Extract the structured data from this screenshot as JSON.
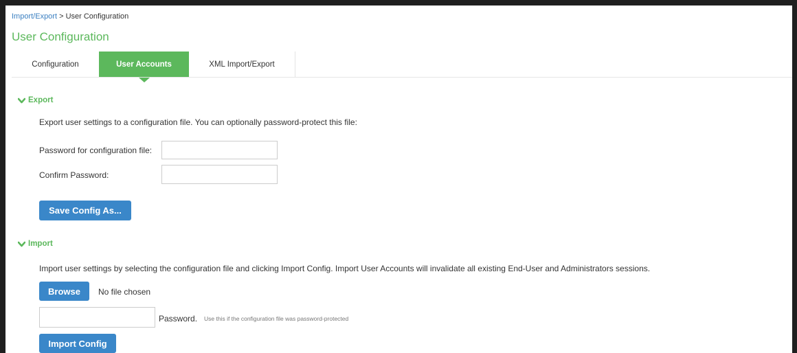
{
  "breadcrumb": {
    "parent": "Import/Export",
    "separator": " > ",
    "current": "User Configuration"
  },
  "page": {
    "title": "User Configuration"
  },
  "tabs": [
    {
      "label": "Configuration",
      "active": false
    },
    {
      "label": "User Accounts",
      "active": true
    },
    {
      "label": "XML Import/Export",
      "active": false
    }
  ],
  "export": {
    "heading": "Export",
    "description": "Export user settings to a configuration file. You can optionally password-protect this file:",
    "password_label": "Password for configuration file:",
    "password_value": "",
    "confirm_label": "Confirm Password:",
    "confirm_value": "",
    "save_button": "Save Config As..."
  },
  "import": {
    "heading": "Import",
    "description": "Import user settings by selecting the configuration file and clicking Import Config. Import User Accounts will invalidate all existing End-User and Administrators sessions.",
    "browse_button": "Browse",
    "file_status": "No file chosen",
    "password_value": "",
    "password_label": "Password.",
    "password_hint": "Use this if the configuration file was password-protected",
    "import_button": "Import Config"
  },
  "colors": {
    "accent_green": "#5cb85c",
    "button_blue": "#3a87c9",
    "link_blue": "#3a7fc1",
    "frame": "#1f1f1f"
  },
  "icons": {
    "section_toggle": "chevron-down-icon"
  }
}
